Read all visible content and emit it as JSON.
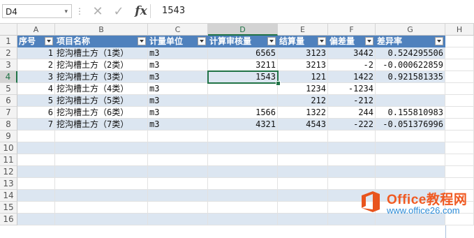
{
  "formula_bar": {
    "name_box": "D4",
    "name_box_arrow": "▾",
    "separator": "⋮",
    "cancel_icon": "✕",
    "enter_icon": "✓",
    "fx_label": "fx",
    "content": "1543"
  },
  "columns": [
    "A",
    "B",
    "C",
    "D",
    "E",
    "F",
    "G",
    "H"
  ],
  "selected_column": "D",
  "rows": [
    "1",
    "2",
    "3",
    "4",
    "5",
    "6",
    "7",
    "8",
    "9",
    "10",
    "11",
    "12",
    "13",
    "14",
    "15",
    "16"
  ],
  "selected_row": "4",
  "table": {
    "headers": [
      "序号",
      "项目名称",
      "计量单位",
      "计算审核量",
      "结算量",
      "偏差量",
      "差异率"
    ],
    "rows": [
      [
        "1",
        "挖沟槽土方（1类）",
        "m3",
        "6565",
        "3123",
        "3442",
        "0.524295506"
      ],
      [
        "2",
        "挖沟槽土方（2类）",
        "m3",
        "3211",
        "3213",
        "-2",
        "-0.000622859"
      ],
      [
        "3",
        "挖沟槽土方（3类）",
        "m3",
        "1543",
        "121",
        "1422",
        "0.921581335"
      ],
      [
        "4",
        "挖沟槽土方（4类）",
        "m3",
        "",
        "1234",
        "-1234",
        ""
      ],
      [
        "5",
        "挖沟槽土方（5类）",
        "m3",
        "",
        "212",
        "-212",
        ""
      ],
      [
        "6",
        "挖沟槽土方（6类）",
        "m3",
        "1566",
        "1322",
        "244",
        "0.155810983"
      ],
      [
        "7",
        "挖沟槽土方（7类）",
        "m3",
        "4321",
        "4543",
        "-222",
        "-0.051376996"
      ]
    ]
  },
  "colors": {
    "header_fill": "#4f81bd",
    "band_fill": "#dce6f1",
    "selection": "#217346"
  },
  "watermark": {
    "title": "Office教程网",
    "url": "www.office26.com",
    "icon": "office-logo-icon"
  }
}
